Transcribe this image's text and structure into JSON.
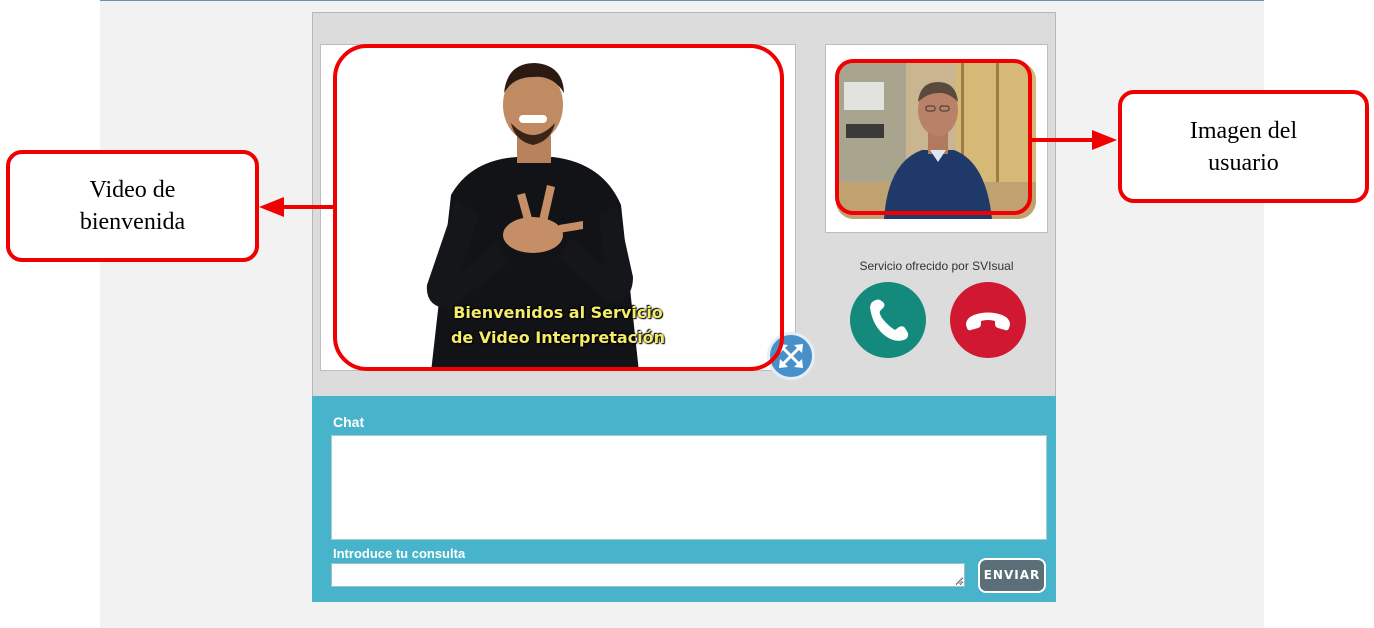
{
  "video": {
    "subtitle_line1": "Bienvenidos al Servicio",
    "subtitle_line2": "de Video Interpretación"
  },
  "service": {
    "provider_text": "Servicio ofrecido por SVIsual"
  },
  "chat": {
    "label": "Chat",
    "query_label": "Introduce tu consulta",
    "query_value": "",
    "send_label": "ENVIAR"
  },
  "annotations": {
    "welcome_video_line1": "Video de",
    "welcome_video_line2": "bienvenida",
    "user_image_line1": "Imagen del",
    "user_image_line2": "usuario"
  },
  "icons": {
    "expand": "expand-arrows-icon",
    "call": "phone-icon",
    "hangup": "hang-up-icon"
  },
  "colors": {
    "highlight": "#f00000",
    "chat_bg": "#47b4cb",
    "call_green": "#138a7c",
    "hangup_red": "#d01833",
    "expand_blue": "#4a90c8"
  }
}
